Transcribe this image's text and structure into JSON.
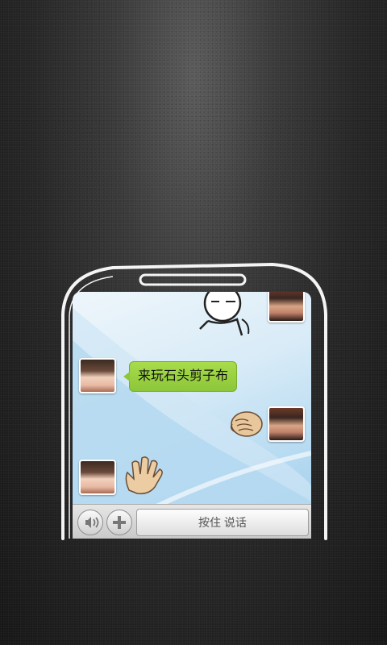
{
  "chat": {
    "message_text": "来玩石头剪子布"
  },
  "input_bar": {
    "voice_icon": "speaker-icon",
    "add_icon": "plus-icon",
    "talk_label": "按住 说话"
  },
  "icons": {
    "fist": "rock-fist-icon",
    "hand": "paper-hand-icon",
    "doodle": "doodle-character-icon"
  },
  "colors": {
    "bubble": "#8cc63a",
    "background": "#262626"
  }
}
